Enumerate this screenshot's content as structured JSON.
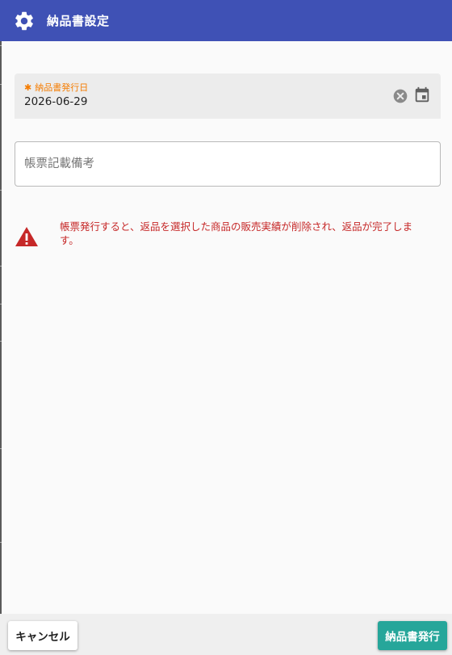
{
  "header": {
    "title": "納品書設定",
    "icon": "gear-icon",
    "background": "#3f51b5"
  },
  "date_field": {
    "required_mark": "✱",
    "label": "納品書発行日",
    "value": "2026-06-29",
    "label_color": "#f57c00",
    "clear_icon": "clear-circle-icon",
    "calendar_icon": "calendar-icon"
  },
  "remarks_field": {
    "placeholder": "帳票記載備考",
    "value": ""
  },
  "warning": {
    "icon": "warning-triangle-icon",
    "message": "帳票発行すると、返品を選択した商品の販売実績が削除され、返品が完了します。",
    "color": "#c62828"
  },
  "footer": {
    "cancel_label": "キャンセル",
    "issue_label": "納品書発行",
    "issue_color": "#26a69a"
  }
}
